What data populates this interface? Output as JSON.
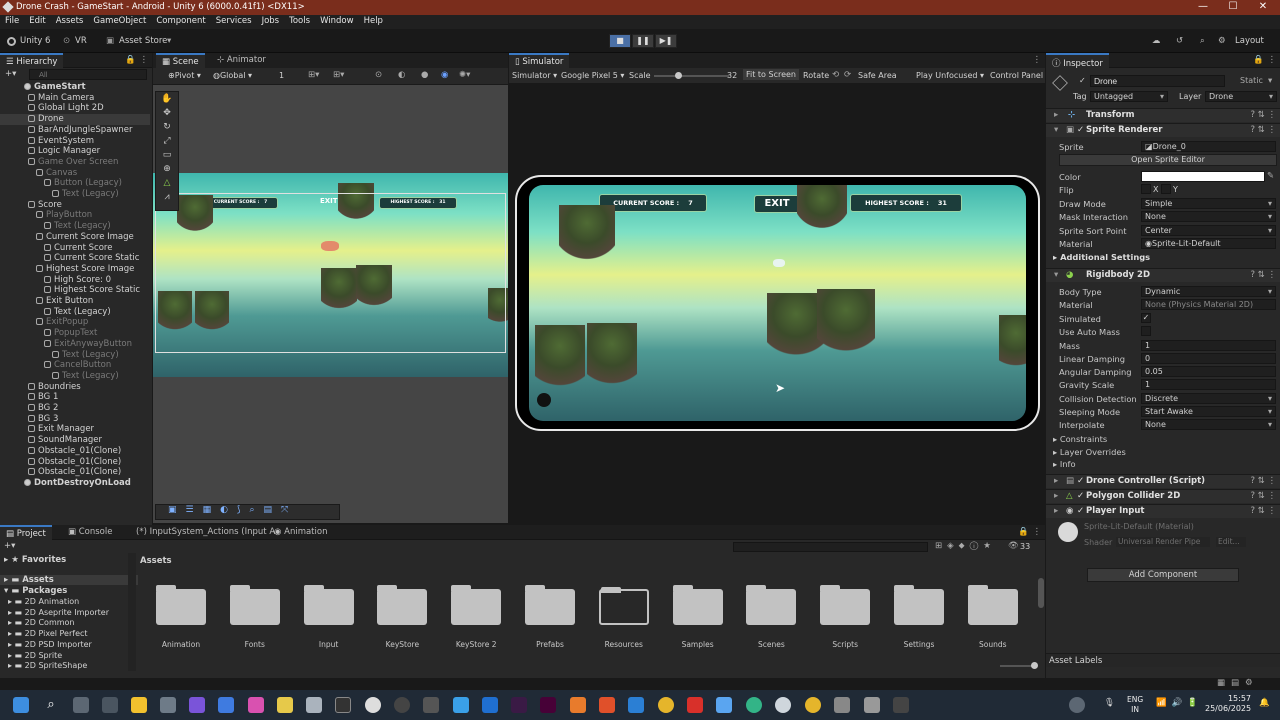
{
  "window": {
    "title": "Drone Crash - GameStart - Android - Unity 6 (6000.0.41f1) <DX11>",
    "minimize": "—",
    "maximize": "☐",
    "close": "✕"
  },
  "menu": [
    "File",
    "Edit",
    "Assets",
    "GameObject",
    "Component",
    "Services",
    "Jobs",
    "Tools",
    "Window",
    "Help"
  ],
  "toolbar": {
    "account": "Unity 6",
    "vr": "VR",
    "asset_store": "Asset Store",
    "layout": "Layout"
  },
  "hierarchy": {
    "tab": "Hierarchy",
    "search_placeholder": "All",
    "items": [
      {
        "label": "GameStart",
        "depth": 0,
        "state": "root"
      },
      {
        "label": "Main Camera",
        "depth": 1,
        "state": "normal"
      },
      {
        "label": "Global Light 2D",
        "depth": 1,
        "state": "normal"
      },
      {
        "label": "Drone",
        "depth": 1,
        "state": "selected"
      },
      {
        "label": "BarAndJungleSpawner",
        "depth": 1,
        "state": "normal"
      },
      {
        "label": "EventSystem",
        "depth": 1,
        "state": "normal"
      },
      {
        "label": "Logic Manager",
        "depth": 1,
        "state": "normal"
      },
      {
        "label": "Game Over Screen",
        "depth": 1,
        "state": "dim"
      },
      {
        "label": "Canvas",
        "depth": 2,
        "state": "dim"
      },
      {
        "label": "Button (Legacy)",
        "depth": 3,
        "state": "dim"
      },
      {
        "label": "Text (Legacy)",
        "depth": 4,
        "state": "dim"
      },
      {
        "label": "Score",
        "depth": 1,
        "state": "normal"
      },
      {
        "label": "PlayButton",
        "depth": 2,
        "state": "dim"
      },
      {
        "label": "Text (Legacy)",
        "depth": 3,
        "state": "dim"
      },
      {
        "label": "Current Score Image",
        "depth": 2,
        "state": "normal"
      },
      {
        "label": "Current Score",
        "depth": 3,
        "state": "normal"
      },
      {
        "label": "Current Score Static",
        "depth": 3,
        "state": "normal"
      },
      {
        "label": "Highest Score Image",
        "depth": 2,
        "state": "normal"
      },
      {
        "label": "High Score: 0",
        "depth": 3,
        "state": "normal"
      },
      {
        "label": "Highest Score Static",
        "depth": 3,
        "state": "normal"
      },
      {
        "label": "Exit Button",
        "depth": 2,
        "state": "normal"
      },
      {
        "label": "Text (Legacy)",
        "depth": 3,
        "state": "normal"
      },
      {
        "label": "ExitPopup",
        "depth": 2,
        "state": "dim"
      },
      {
        "label": "PopupText",
        "depth": 3,
        "state": "dim"
      },
      {
        "label": "ExitAnywayButton",
        "depth": 3,
        "state": "dim"
      },
      {
        "label": "Text (Legacy)",
        "depth": 4,
        "state": "dim"
      },
      {
        "label": "CancelButton",
        "depth": 3,
        "state": "dim"
      },
      {
        "label": "Text (Legacy)",
        "depth": 4,
        "state": "dim"
      },
      {
        "label": "Boundries",
        "depth": 1,
        "state": "normal"
      },
      {
        "label": "BG 1",
        "depth": 1,
        "state": "normal"
      },
      {
        "label": "BG 2",
        "depth": 1,
        "state": "normal"
      },
      {
        "label": "BG 3",
        "depth": 1,
        "state": "normal"
      },
      {
        "label": "Exit Manager",
        "depth": 1,
        "state": "normal"
      },
      {
        "label": "SoundManager",
        "depth": 1,
        "state": "normal"
      },
      {
        "label": "Obstacle_01(Clone)",
        "depth": 1,
        "state": "normal"
      },
      {
        "label": "Obstacle_01(Clone)",
        "depth": 1,
        "state": "normal"
      },
      {
        "label": "Obstacle_01(Clone)",
        "depth": 1,
        "state": "normal"
      },
      {
        "label": "DontDestroyOnLoad",
        "depth": 0,
        "state": "root"
      }
    ]
  },
  "scene": {
    "tab_scene": "Scene",
    "tab_animator": "Animator",
    "pivot": "Pivot",
    "global": "Global",
    "step": "1"
  },
  "game": {
    "current_score_label": "CURRENT SCORE :",
    "current_score": "7",
    "exit": "EXIT",
    "highest_score_label": "HIGHEST SCORE :",
    "highest_score": "31"
  },
  "simulator": {
    "tab": "Simulator",
    "mode": "Simulator",
    "device": "Google Pixel 5",
    "scale_label": "Scale",
    "scale_value": "32",
    "scale_fraction": 0.32,
    "fit": "Fit to Screen",
    "rotate": "Rotate",
    "safe_area": "Safe Area",
    "play_mode": "Play Unfocused",
    "control_panel": "Control Panel"
  },
  "inspector": {
    "tab": "Inspector",
    "object_name": "Drone",
    "static": "Static",
    "tag_label": "Tag",
    "tag": "Untagged",
    "layer_label": "Layer",
    "layer": "Drone",
    "transform": "Transform",
    "sprite_renderer": "Sprite Renderer",
    "sprite_label": "Sprite",
    "sprite": "Drone_0",
    "open_sprite_editor": "Open Sprite Editor",
    "color_label": "Color",
    "color": "#ffffff",
    "flip_label": "Flip",
    "flip_x": "X",
    "flip_y": "Y",
    "draw_mode_label": "Draw Mode",
    "draw_mode": "Simple",
    "mask_label": "Mask Interaction",
    "mask": "None",
    "sort_point_label": "Sprite Sort Point",
    "sort_point": "Center",
    "material_label": "Material",
    "material": "Sprite-Lit-Default",
    "additional_settings": "Additional Settings",
    "rigidbody": "Rigidbody 2D",
    "body_type_label": "Body Type",
    "body_type": "Dynamic",
    "rb_material_label": "Material",
    "rb_material": "None (Physics Material 2D)",
    "simulated_label": "Simulated",
    "auto_mass_label": "Use Auto Mass",
    "mass_label": "Mass",
    "mass": "1",
    "linear_label": "Linear Damping",
    "linear": "0",
    "angular_label": "Angular Damping",
    "angular": "0.05",
    "gravity_label": "Gravity Scale",
    "gravity": "1",
    "collision_label": "Collision Detection",
    "collision": "Discrete",
    "sleeping_label": "Sleeping Mode",
    "sleeping": "Start Awake",
    "interpolate_label": "Interpolate",
    "interpolate": "None",
    "constraints": "Constraints",
    "layer_overrides": "Layer Overrides",
    "info": "Info",
    "drone_controller": "Drone Controller (Script)",
    "polygon_collider": "Polygon Collider 2D",
    "player_input": "Player Input",
    "material_preview": "Sprite-Lit-Default (Material)",
    "shader_label": "Shader",
    "shader": "Universal Render Pipe",
    "edit": "Edit...",
    "add_component": "Add Component",
    "asset_labels": "Asset Labels"
  },
  "bottom": {
    "tabs": [
      "Project",
      "Console",
      "(*) InputSystem_Actions (Input A",
      "Animation"
    ],
    "favorites": "Favorites",
    "assets_root": "Assets",
    "packages": "Packages",
    "package_items": [
      "2D Animation",
      "2D Aseprite Importer",
      "2D Common",
      "2D Pixel Perfect",
      "2D PSD Importer",
      "2D Sprite",
      "2D SpriteShape"
    ],
    "breadcrumb": "Assets",
    "count": "33",
    "folders": [
      "Animation",
      "Fonts",
      "Input",
      "KeyStore",
      "KeyStore 2",
      "Prefabs",
      "Resources",
      "Samples",
      "Scenes",
      "Scripts",
      "Settings",
      "Sounds"
    ]
  },
  "taskbar": {
    "lang": "ENG",
    "region": "IN",
    "time": "15:57",
    "date": "25/06/2025"
  }
}
